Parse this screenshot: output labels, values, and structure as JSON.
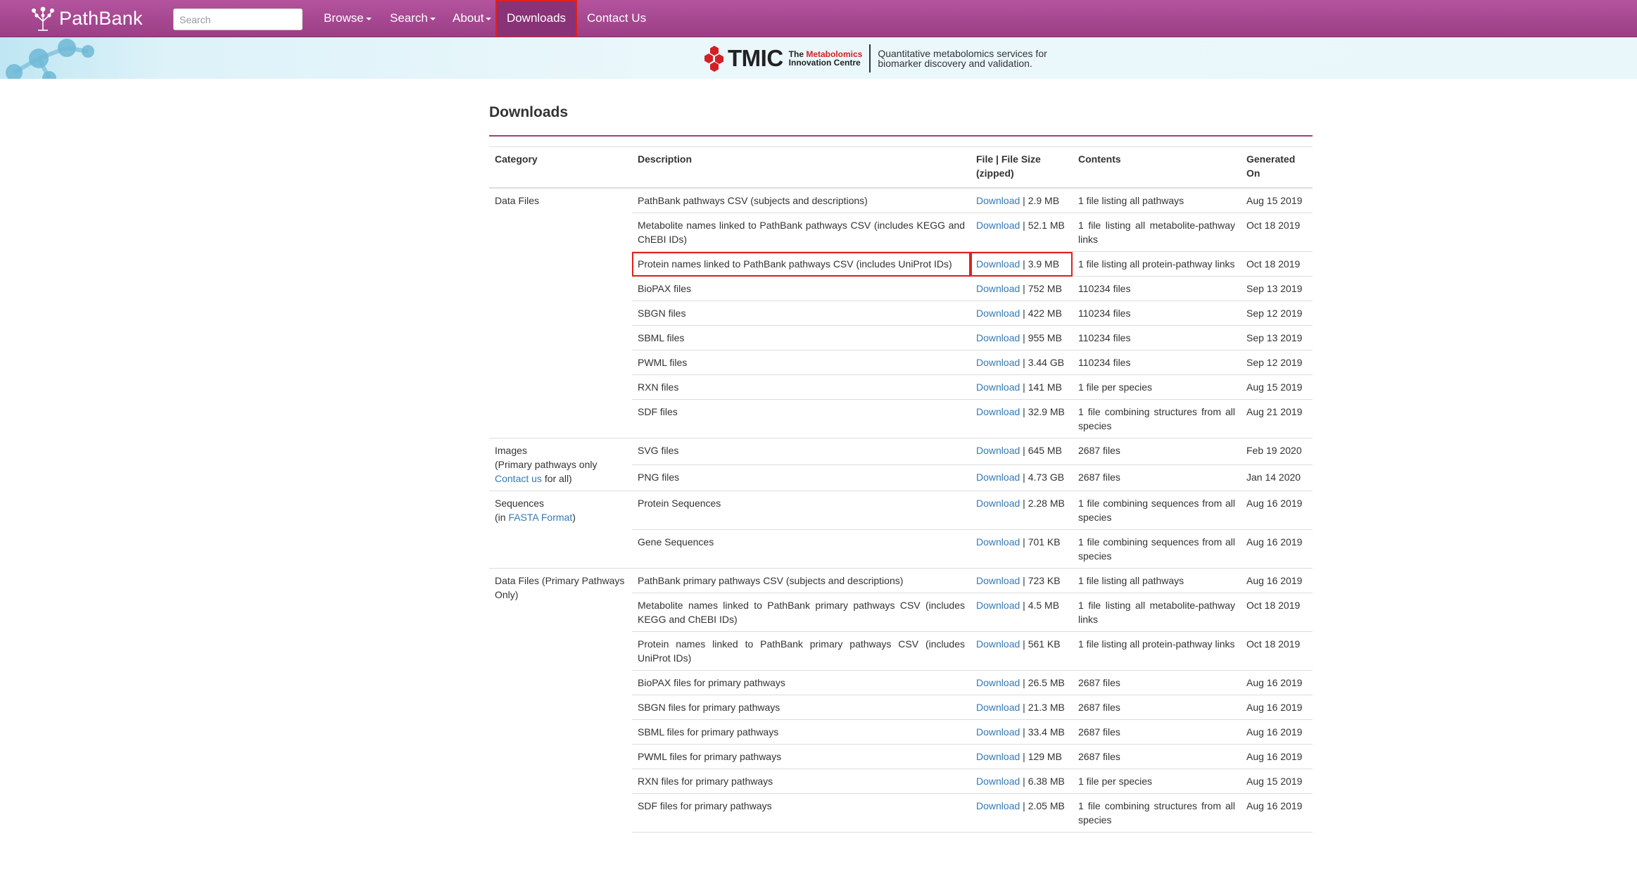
{
  "nav": {
    "brand": "PathBank",
    "search_placeholder": "Search",
    "browse": "Browse",
    "search_menu": "Search",
    "about": "About",
    "downloads": "Downloads",
    "contact": "Contact Us",
    "accent": "#a44892"
  },
  "banner": {
    "tmic": "TMIC",
    "the": "The ",
    "metabolomics": "Metabolomics",
    "innovation": "Innovation Centre",
    "tag1": "Quantitative metabolomics services for",
    "tag2": "biomarker discovery and validation."
  },
  "page": {
    "title": "Downloads",
    "headers": [
      "Category",
      "Description",
      "File | File Size (zipped)",
      "Contents",
      "Generated On"
    ],
    "download_label": "Download"
  },
  "groups": [
    {
      "category": "Data Files",
      "rows": [
        {
          "desc": "PathBank pathways CSV (subjects and descriptions)",
          "size": "2.9 MB",
          "contents": "1 file listing all pathways",
          "date": "Aug 15 2019"
        },
        {
          "desc": "Metabolite names linked to PathBank pathways CSV (includes KEGG and ChEBI IDs)",
          "size": "52.1 MB",
          "contents": "1 file listing all metabolite-pathway links",
          "date": "Oct 18 2019"
        },
        {
          "desc": "Protein names linked to PathBank pathways CSV (includes UniProt IDs)",
          "size": "3.9 MB",
          "contents": "1 file listing all protein-pathway links",
          "date": "Oct 18 2019",
          "highlight": true
        },
        {
          "desc": "BioPAX files",
          "size": "752 MB",
          "contents": "110234 files",
          "date": "Sep 13 2019"
        },
        {
          "desc": "SBGN files",
          "size": "422 MB",
          "contents": "110234 files",
          "date": "Sep 12 2019"
        },
        {
          "desc": "SBML files",
          "size": "955 MB",
          "contents": "110234 files",
          "date": "Sep 13 2019"
        },
        {
          "desc": "PWML files",
          "size": "3.44 GB",
          "contents": "110234 files",
          "date": "Sep 12 2019"
        },
        {
          "desc": "RXN files",
          "size": "141 MB",
          "contents": "1 file per species",
          "date": "Aug 15 2019"
        },
        {
          "desc": "SDF files",
          "size": "32.9 MB",
          "contents": "1 file combining structures from all species",
          "date": "Aug 21 2019"
        }
      ]
    },
    {
      "category_lines": [
        "Images",
        "(Primary pathways only"
      ],
      "category_link": "Contact us",
      "category_after": " for all)",
      "rows": [
        {
          "desc": "SVG files",
          "size": "645 MB",
          "contents": "2687 files",
          "date": "Feb 19 2020"
        },
        {
          "desc": "PNG files",
          "size": "4.73 GB",
          "contents": "2687 files",
          "date": "Jan 14 2020"
        }
      ]
    },
    {
      "category_lines": [
        "Sequences"
      ],
      "category_prefix": "(in ",
      "category_link": "FASTA Format",
      "category_after": ")",
      "rows": [
        {
          "desc": "Protein Sequences",
          "size": "2.28 MB",
          "contents": "1 file combining sequences from all species",
          "date": "Aug 16 2019"
        },
        {
          "desc": "Gene Sequences",
          "size": "701 KB",
          "contents": "1 file combining sequences from all species",
          "date": "Aug 16 2019"
        }
      ]
    },
    {
      "category": "Data Files (Primary Pathways Only)",
      "rows": [
        {
          "desc": "PathBank primary pathways CSV (subjects and descriptions)",
          "size": "723 KB",
          "contents": "1 file listing all pathways",
          "date": "Aug 16 2019"
        },
        {
          "desc": "Metabolite names linked to PathBank primary pathways CSV (includes KEGG and ChEBI IDs)",
          "size": "4.5 MB",
          "contents": "1 file listing all metabolite-pathway links",
          "date": "Oct 18 2019"
        },
        {
          "desc": "Protein names linked to PathBank primary pathways CSV (includes UniProt IDs)",
          "size": "561 KB",
          "contents": "1 file listing all protein-pathway links",
          "date": "Oct 18 2019"
        },
        {
          "desc": "BioPAX files for primary pathways",
          "size": "26.5 MB",
          "contents": "2687 files",
          "date": "Aug 16 2019"
        },
        {
          "desc": "SBGN files for primary pathways",
          "size": "21.3 MB",
          "contents": "2687 files",
          "date": "Aug 16 2019"
        },
        {
          "desc": "SBML files for primary pathways",
          "size": "33.4 MB",
          "contents": "2687 files",
          "date": "Aug 16 2019"
        },
        {
          "desc": "PWML files for primary pathways",
          "size": "129 MB",
          "contents": "2687 files",
          "date": "Aug 16 2019"
        },
        {
          "desc": "RXN files for primary pathways",
          "size": "6.38 MB",
          "contents": "1 file per species",
          "date": "Aug 15 2019"
        },
        {
          "desc": "SDF files for primary pathways",
          "size": "2.05 MB",
          "contents": "1 file combining structures from all species",
          "date": "Aug 16 2019"
        }
      ]
    }
  ]
}
